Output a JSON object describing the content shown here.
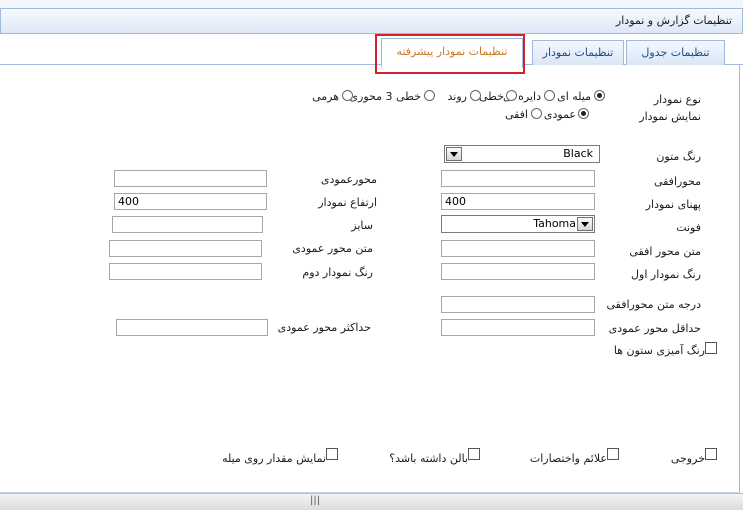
{
  "header": {
    "title": "تنظیمات گزارش و نمودار"
  },
  "tabs": [
    {
      "label": "تنظیمات جدول"
    },
    {
      "label": "تنظیمات نمودار"
    },
    {
      "label": "تنظیمات نمودار پیشرفته",
      "active": true
    }
  ],
  "chart_type": {
    "label": "نوع نمودار",
    "options": [
      "میله ای",
      "دایره ای",
      "خطی",
      "روند",
      "خطی 3 محوری",
      "هرمی"
    ],
    "selected": "میله ای"
  },
  "chart_display": {
    "label": "نمایش نمودار",
    "options": [
      "عمودی",
      "افقی"
    ],
    "selected": "عمودی"
  },
  "fields": {
    "text_color": {
      "label": "رنگ متون",
      "value": "Black"
    },
    "horizontal_axis": {
      "label": "محورافقی",
      "value": ""
    },
    "vertical_axis": {
      "label": "محورعمودی",
      "value": ""
    },
    "chart_width": {
      "label": "پهنای نمودار",
      "value": "400"
    },
    "chart_height": {
      "label": "ارتفاع نمودار",
      "value": "400"
    },
    "font": {
      "label": "فونت",
      "value": "Tahoma"
    },
    "size": {
      "label": "سایز",
      "value": ""
    },
    "horizontal_axis_text": {
      "label": "متن محور افقی",
      "value": ""
    },
    "vertical_axis_text": {
      "label": "متن محور عمودی",
      "value": ""
    },
    "first_chart_color": {
      "label": "رنگ نمودار اول",
      "value": ""
    },
    "second_chart_color": {
      "label": "رنگ نمودار دوم",
      "value": ""
    },
    "horizontal_axis_text_degree": {
      "label": "درجه متن محورافقی",
      "value": ""
    },
    "vertical_axis_min": {
      "label": "حداقل محور عمودی",
      "value": ""
    },
    "vertical_axis_max": {
      "label": "حداکثر محور عمودی",
      "value": ""
    }
  },
  "checkboxes": {
    "column_coloring": "رنگ آمیزی ستون ها",
    "output": "خروجی",
    "signs_abbreviations": "علائم واختصارات",
    "has_balloon": "بالن داشته باشد؟",
    "show_value_on_bar": "نمایش مقدار روی میله"
  },
  "colors": {
    "accent": "#1b4f8a",
    "active_tab_text": "#c87a22",
    "highlight": "#d4202a",
    "border": "#9fbadd"
  },
  "statusbar": {
    "grip": "|||"
  }
}
